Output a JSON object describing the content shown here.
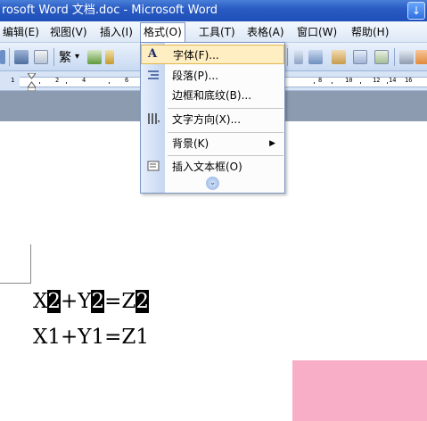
{
  "window": {
    "title": "rosoft Word 文档.doc - Microsoft Word",
    "button_icon": "download-arrow-icon"
  },
  "menubar": {
    "items": [
      {
        "label": "编辑(E)"
      },
      {
        "label": "视图(V)"
      },
      {
        "label": "插入(I)"
      },
      {
        "label": "格式(O)"
      },
      {
        "label": "工具(T)"
      },
      {
        "label": "表格(A)"
      },
      {
        "label": "窗口(W)"
      },
      {
        "label": "帮助(H)"
      }
    ],
    "active_index": 3
  },
  "toolbar": {
    "traditional_chinese_label": "繁",
    "dropdown_glyph": "▾"
  },
  "ruler": {
    "numbers": [
      "1",
      "2",
      "4",
      "6",
      "8",
      "10",
      "12",
      "14",
      "16"
    ]
  },
  "format_menu": {
    "items": [
      {
        "label": "字体(F)...",
        "icon": "font-a-icon",
        "highlighted": true
      },
      {
        "label": "段落(P)...",
        "icon": "paragraph-icon"
      },
      {
        "label": "边框和底纹(B)..."
      },
      {
        "label": "文字方向(X)...",
        "icon": "text-direction-icon"
      },
      {
        "label": "背景(K)",
        "submenu": true
      },
      {
        "label": "插入文本框(O)",
        "icon": "textbox-icon"
      }
    ],
    "submenu_arrow": "▶",
    "expand_glyph": "⌄"
  },
  "document": {
    "line1": {
      "p1": "X",
      "s1": "2",
      "p2": "+Y",
      "s2": "2",
      "p3": "=Z",
      "s3": "2"
    },
    "line2": "X1+Y1=Z1"
  },
  "colors": {
    "title_bar": "#2a5cc4",
    "menu_highlight": "#ffeec2",
    "selection": "#000000",
    "pink_block": "#f8aec6"
  }
}
